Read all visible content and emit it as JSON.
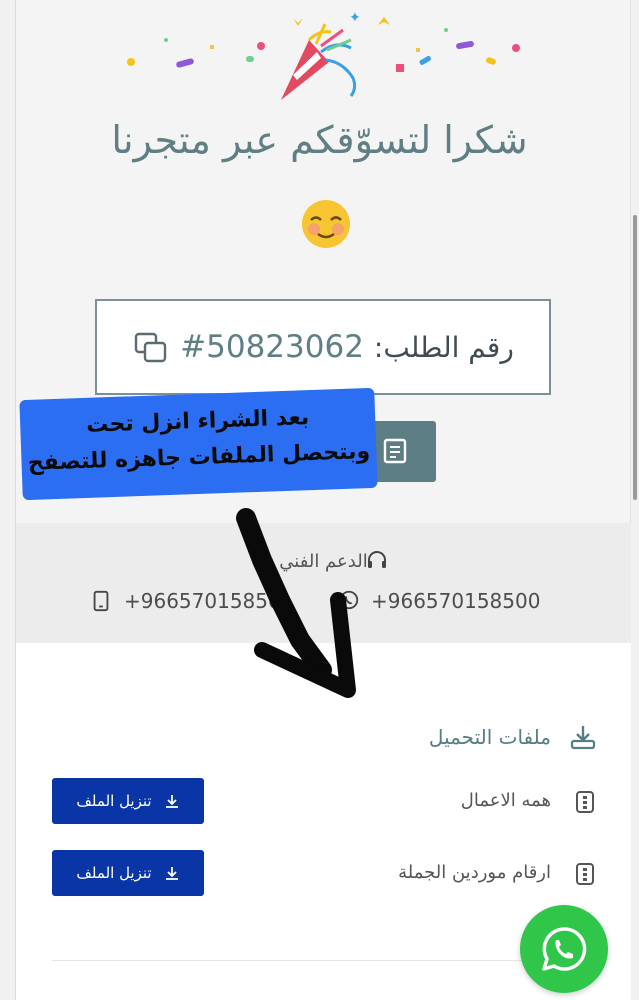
{
  "thanks_title": "شكرا لتسوّقكم عبر متجرنا",
  "order": {
    "label": "رقم الطلب:",
    "number": "#50823062"
  },
  "annotation": {
    "line1": "بعد الشراء انزل تحت",
    "line2": "وبتحصل الملفات جاهزه للتصفح"
  },
  "support": {
    "title": "الدعم الفني",
    "phone_whatsapp": "+966570158500",
    "phone_mobile": "+96657015850"
  },
  "downloads": {
    "title": "ملفات التحميل",
    "files": [
      {
        "name": "همه الاعمال",
        "button_label": "تنزيل الملف"
      },
      {
        "name": "ارقام موردين الجملة",
        "button_label": "تنزيل الملف"
      }
    ]
  },
  "colors": {
    "accent": "#5d7e84",
    "download_button": "#0a35a6",
    "whatsapp": "#2fc64a",
    "note_highlight": "#2b6ef1"
  }
}
